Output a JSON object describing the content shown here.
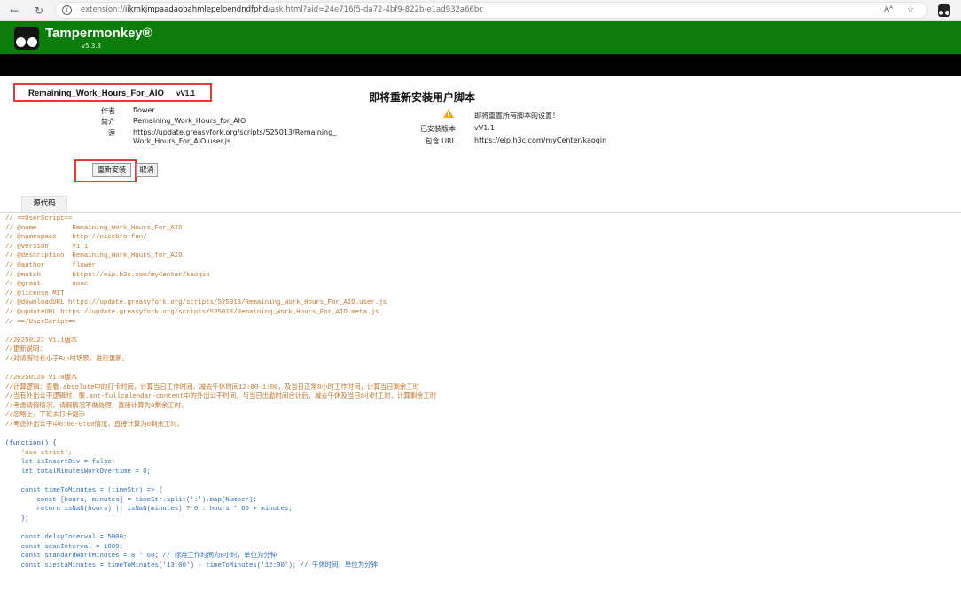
{
  "browser": {
    "url_prefix": "extension://",
    "url_host": "iikmkjmpaadaobahmlepeloendndfphd",
    "url_path": "/ask.html?aid=24e716f5-da72-4bf9-822b-e1ad932a66bc",
    "read_aloud": "Aᴬ"
  },
  "header": {
    "app_name": "Tampermonkey®",
    "version": "v5.3.3"
  },
  "script": {
    "name": "Remaining_Work_Hours_For_AIO",
    "version": "vV1.1",
    "author_label": "作者",
    "author": "flower",
    "desc_label": "简介",
    "description": "Remaining_Work_Hours_for_AIO",
    "source_label": "源",
    "source_line1": "https://update.greasyfork.org/scripts/525013/Remaining_",
    "source_line2": "Work_Hours_For_AIO.user.js"
  },
  "buttons": {
    "reinstall": "重新安装",
    "cancel": "取消"
  },
  "panel": {
    "title": "即将重新安装用户脚本",
    "warning_icon": "warning-icon",
    "warning": "即将重置所有脚本的设置！",
    "installed_label": "已安装版本",
    "installed_value": "vV1.1",
    "include_label": "包含 URL",
    "include_value": "https://eip.h3c.com/myCenter/kaoqin"
  },
  "tab": {
    "source": "源代码"
  },
  "code_lines": [
    {
      "t": "// ==UserScript==",
      "c": "comment"
    },
    {
      "t": "// @name         Remaining_Work_Hours_For_AIO",
      "c": "comment"
    },
    {
      "t": "// @namespace    http://nicebro.fun/",
      "c": "comment"
    },
    {
      "t": "// @version      V1.1",
      "c": "comment"
    },
    {
      "t": "// @description  Remaining_Work_Hours_for_AIO",
      "c": "comment"
    },
    {
      "t": "// @author       flower",
      "c": "comment"
    },
    {
      "t": "// @match        https://eip.h3c.com/myCenter/kaoqin",
      "c": "comment"
    },
    {
      "t": "// @grant        none",
      "c": "comment"
    },
    {
      "t": "// @license MIT",
      "c": "comment"
    },
    {
      "t": "// @downloadURL https://update.greasyfork.org/scripts/525013/Remaining_Work_Hours_For_AIO.user.js",
      "c": "comment"
    },
    {
      "t": "// @updateURL https://update.greasyfork.org/scripts/525013/Remaining_Work_Hours_For_AIO.meta.js",
      "c": "comment"
    },
    {
      "t": "// ==/UserScript==",
      "c": "comment"
    },
    {
      "t": "",
      "c": "default"
    },
    {
      "t": "//20250127 V1.1版本",
      "c": "comment"
    },
    {
      "t": "//更新说明：",
      "c": "comment"
    },
    {
      "t": "//对请假时长小于8小时场景，进行更新。",
      "c": "comment"
    },
    {
      "t": "",
      "c": "default"
    },
    {
      "t": "//20250126 V1.0版本",
      "c": "comment"
    },
    {
      "t": "//计算逻辑：查看.absolute中的打卡时间，计算当日工作时间，减去午休时间12:00-1:00，及当日正常8小时工作时间，计算当日剩余工时",
      "c": "comment"
    },
    {
      "t": "//当有外出公干逻辑时，取.ant-fullcalendar-content中的外出公干时间，与当日出勤时间合计后，减去午休及当日8小时工时，计算剩余工时",
      "c": "comment"
    },
    {
      "t": "//考虑请假情况，请假情况不做处理，直接计算为0剩余工时。",
      "c": "comment"
    },
    {
      "t": "//忽略上、下班未打卡提示",
      "c": "comment"
    },
    {
      "t": "//考虑外出公干中0:00-0:00情况，直接计算为0剩余工时。",
      "c": "comment"
    },
    {
      "t": "",
      "c": "default"
    },
    {
      "t": "(function() {",
      "c": "keyword"
    },
    {
      "t": "    'use strict';",
      "c": "comment"
    },
    {
      "t": "    let isInsertDiv = false;",
      "c": "default"
    },
    {
      "t": "    let totalMinutesWorkOvertime = 0;",
      "c": "default"
    },
    {
      "t": "",
      "c": "default"
    },
    {
      "t": "    const timeToMinutes = (timeStr) => {",
      "c": "default"
    },
    {
      "t": "        const [hours, minutes] = timeStr.split(':').map(Number);",
      "c": "default"
    },
    {
      "t": "        return isNaN(hours) || isNaN(minutes) ? 0 : hours * 60 + minutes;",
      "c": "default"
    },
    {
      "t": "    };",
      "c": "keyword"
    },
    {
      "t": "",
      "c": "default"
    },
    {
      "t": "    const delayInterval = 5000;",
      "c": "default"
    },
    {
      "t": "    const scanInterval = 1000;",
      "c": "default"
    },
    {
      "t": "    const standardWorkMinutes = 8 * 60; // 标准工作时间为8小时，单位为分钟",
      "c": "default"
    },
    {
      "t": "    const siestaMinutes = timeToMinutes('13:00') - timeToMinutes('12:00'); // 午休时间，单位为分钟",
      "c": "default"
    }
  ]
}
